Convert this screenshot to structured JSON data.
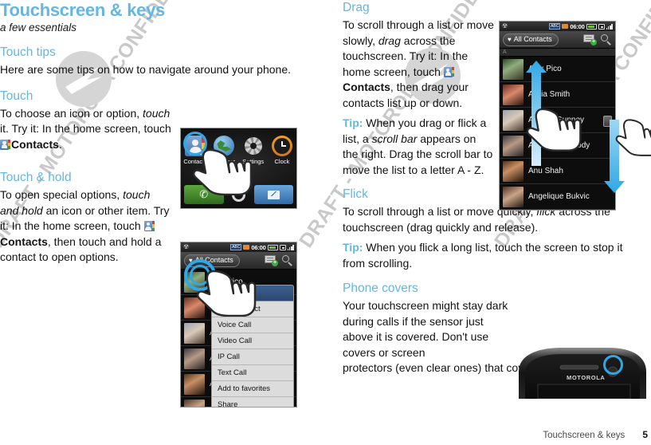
{
  "doc": {
    "title": "Touchscreen & keys",
    "subtitle": "a few essentials",
    "footer_label": "Touchscreen & keys",
    "page_number": "5",
    "watermark": "DRAFT - MOTOROLA CONFIDENTIAL & PROPRIETARY INFORMATION",
    "heading_color": "#63b6e5"
  },
  "left": {
    "touch_tips": {
      "heading": "Touch tips",
      "body": "Here are some tips on how to navigate around your phone."
    },
    "touch": {
      "heading": "Touch",
      "p1": "To choose an icon or option,",
      "em1": "touch",
      "p2": "it. Try it: In the home screen, touch",
      "strong1": "Contacts",
      "p3": "."
    },
    "touch_hold": {
      "heading": "Touch & hold",
      "p1": "To open special options,",
      "em1": "touch and hold",
      "p2": "an icon or other item. Try it: In the home screen, touch",
      "strong1": "Contacts",
      "p3": ", then touch and hold a contact to open options."
    }
  },
  "right": {
    "drag": {
      "heading": "Drag",
      "p1": "To scroll through a list or move slowly,",
      "em1": "drag",
      "p2": "across the touchscreen. Try it: In the home screen, touch",
      "strong1": "Contacts",
      "p3": ", then drag your contacts list up or down.",
      "tip_label": "Tip:",
      "tip_p1": "When you drag or flick a list, a",
      "tip_em": "scroll bar",
      "tip_p2": "appears on the right. Drag the scroll bar to move the list to a letter A - Z."
    },
    "flick": {
      "heading": "Flick",
      "body": "To scroll through a list or move quickly, flick across the touchscreen (drag quickly and release).",
      "body_em": "flick",
      "body_a": "To scroll through a list or move quickly,",
      "body_b": "across the touchscreen (drag quickly and release).",
      "tip_label": "Tip:",
      "tip_body": "When you flick a long list, touch the screen to stop it from scrolling."
    },
    "phone_covers": {
      "heading": "Phone covers",
      "body_a": "Your touchscreen might stay dark during calls if the sensor just above it is covered. Don't use covers or screen",
      "body_b": "protectors (even clear ones) that cover this sensor."
    }
  },
  "home_screen": {
    "icons": [
      {
        "label": "Contacts",
        "icon": "contacts-icon"
      },
      {
        "label": "Browser",
        "icon": "browser-icon"
      },
      {
        "label": "Settings",
        "icon": "settings-gear-icon"
      },
      {
        "label": "Clock",
        "icon": "clock-icon"
      }
    ],
    "dock": [
      {
        "name": "phone-dock-button",
        "icon": "phone-handset-icon"
      },
      {
        "name": "home-dock-button",
        "icon": "home-circle-icon"
      },
      {
        "name": "messaging-dock-button",
        "icon": "envelope-icon"
      }
    ]
  },
  "phone_status_bar": {
    "time": "06:00",
    "usb_icon": "usb-icon",
    "keyboard_icon": "abc-keyboard-icon",
    "sd_icon": "sd-card-icon",
    "battery_icon": "battery-icon",
    "vibrate_icon": "vibrate-icon",
    "signal_icon": "signal-bars-icon"
  },
  "contacts_app": {
    "filter_label": "All Contacts",
    "filter_icon": "heart-icon",
    "new_contact_icon": "new-contact-icon",
    "search_icon": "search-icon",
    "section_letter": "A",
    "contacts": [
      "Alex Pico",
      "Alicia Smith",
      "Andrea Gunney",
      "Andrew Carmody",
      "Anu Shah",
      "Angelique Bukvic"
    ]
  },
  "context_menu": {
    "header": "Alex Pico",
    "items": [
      "View contact",
      "Voice Call",
      "Video Call",
      "IP Call",
      "Text Call",
      "Add to favorites",
      "Share"
    ]
  },
  "moto_photo": {
    "brand": "MOTOROLA",
    "callout": "proximity-sensor-highlight"
  }
}
